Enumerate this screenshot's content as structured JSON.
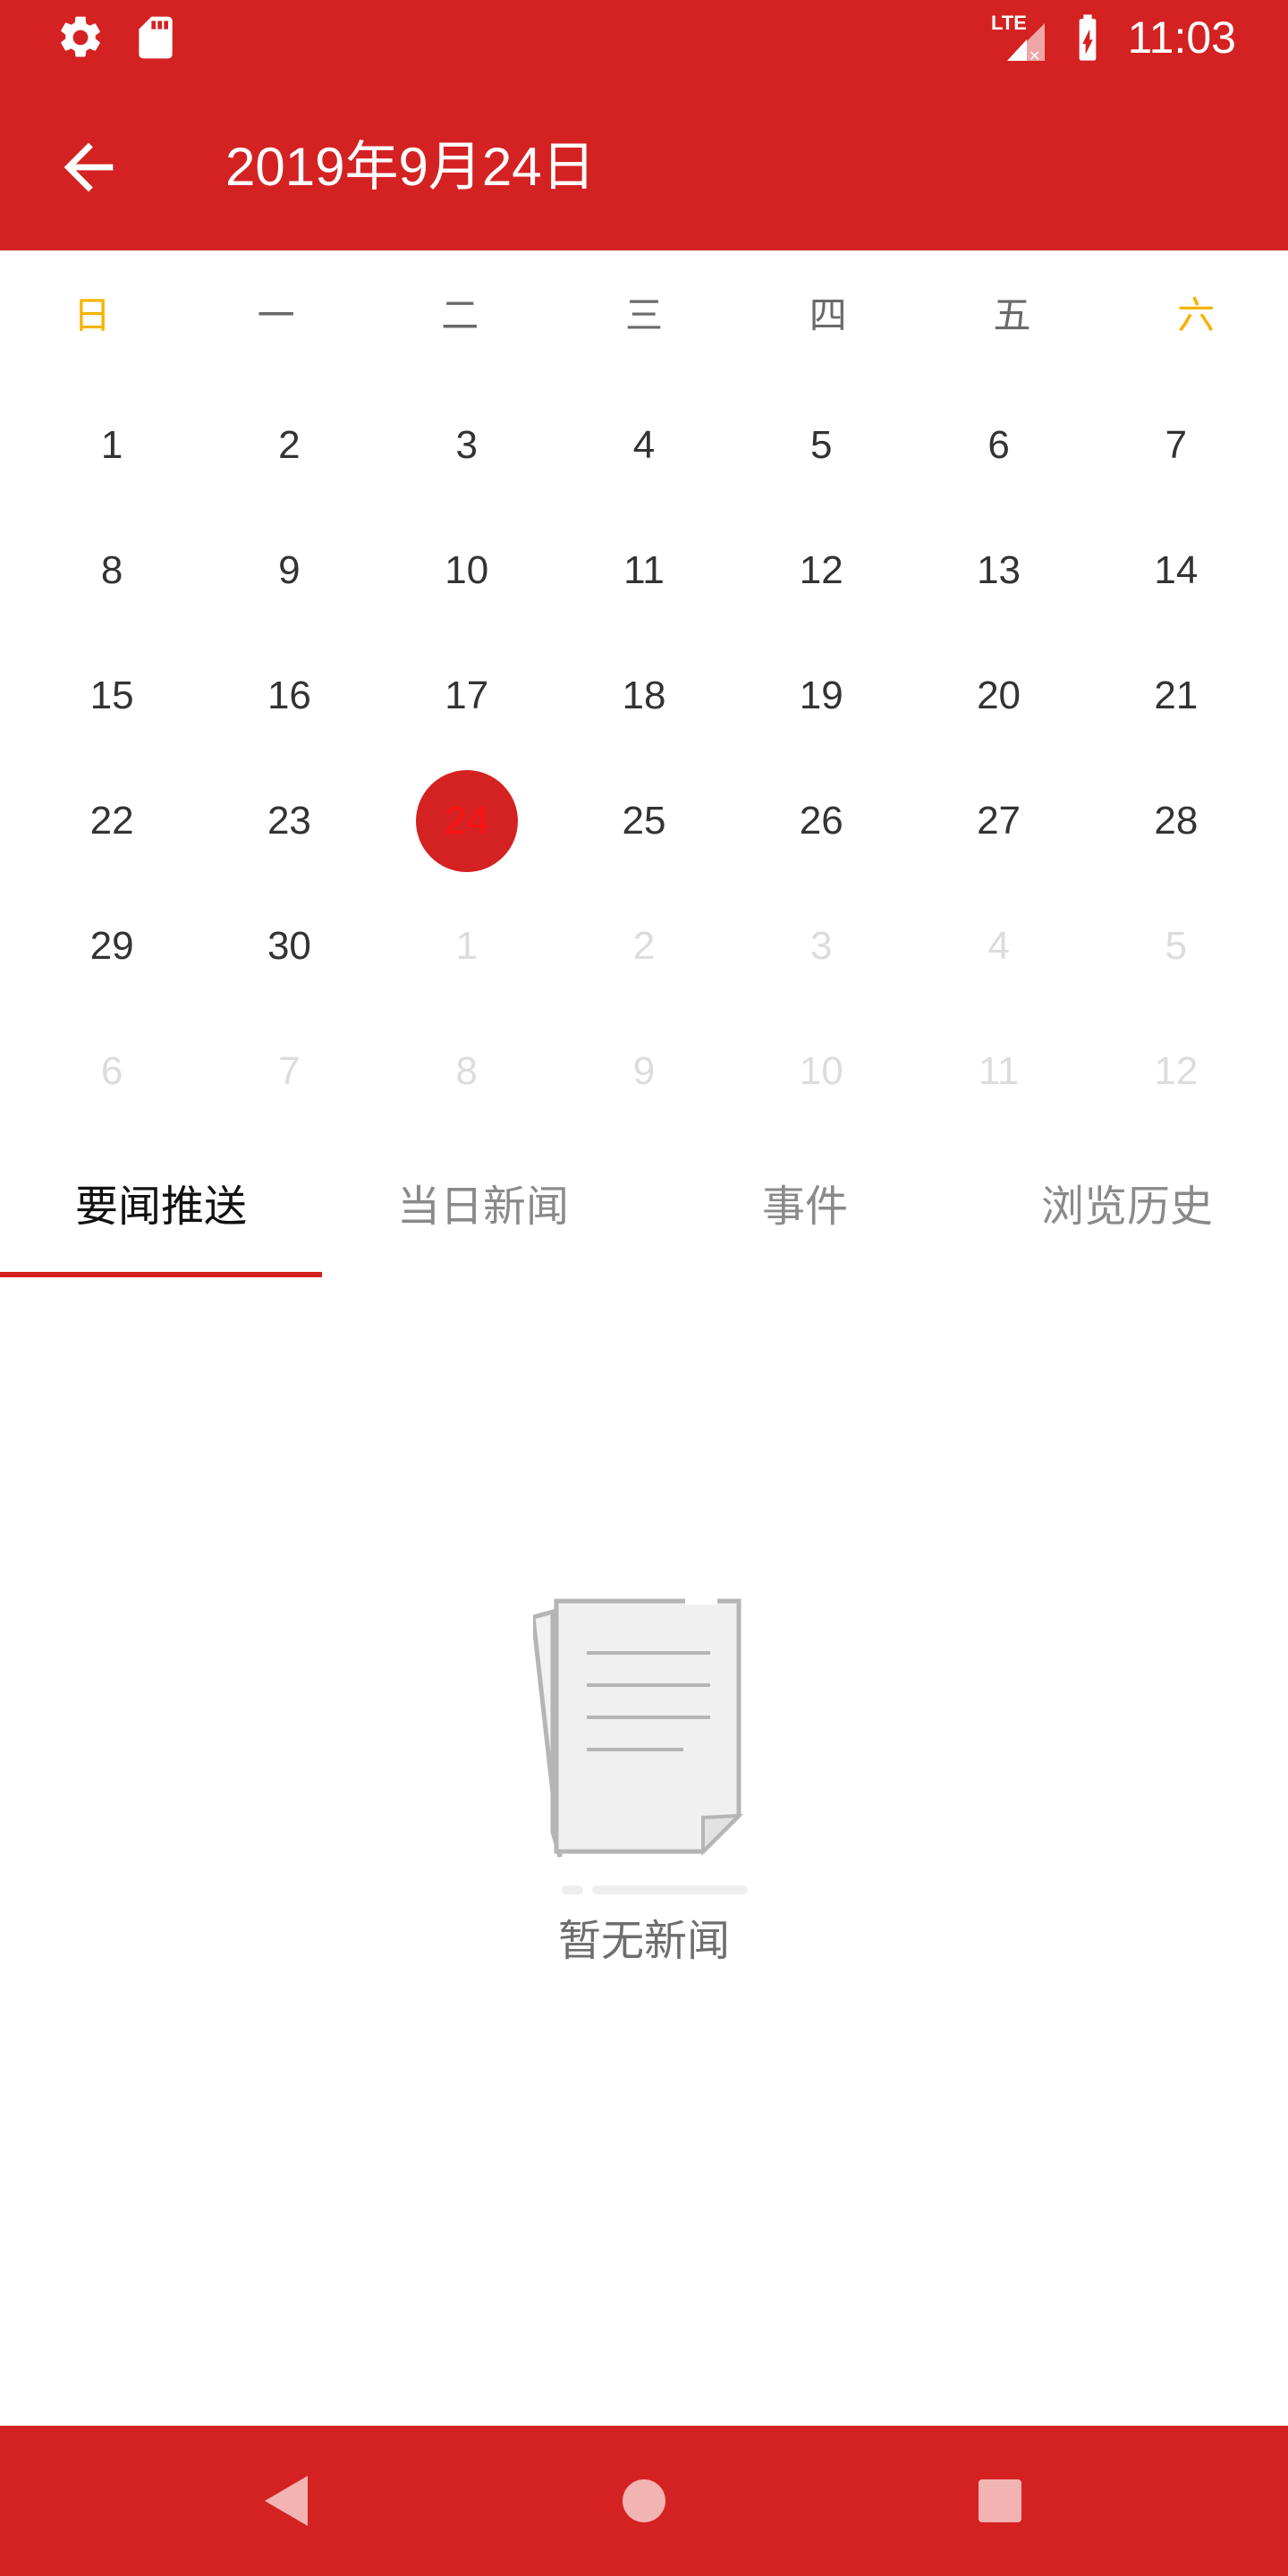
{
  "status_bar": {
    "time": "11:03",
    "network": "LTE",
    "icons": [
      "settings-icon",
      "sd-card-icon",
      "signal-icon",
      "battery-charging-icon"
    ]
  },
  "app_bar": {
    "title": "2019年9月24日",
    "back_icon": "arrow-left-icon"
  },
  "calendar": {
    "weekdays": [
      "日",
      "一",
      "二",
      "三",
      "四",
      "五",
      "六"
    ],
    "weekend_color": "#f5b400",
    "selected_day": "24",
    "accent": "#d42222",
    "days": [
      {
        "label": "1",
        "muted": false
      },
      {
        "label": "2",
        "muted": false
      },
      {
        "label": "3",
        "muted": false
      },
      {
        "label": "4",
        "muted": false
      },
      {
        "label": "5",
        "muted": false
      },
      {
        "label": "6",
        "muted": false
      },
      {
        "label": "7",
        "muted": false
      },
      {
        "label": "8",
        "muted": false
      },
      {
        "label": "9",
        "muted": false
      },
      {
        "label": "10",
        "muted": false
      },
      {
        "label": "11",
        "muted": false
      },
      {
        "label": "12",
        "muted": false
      },
      {
        "label": "13",
        "muted": false
      },
      {
        "label": "14",
        "muted": false
      },
      {
        "label": "15",
        "muted": false
      },
      {
        "label": "16",
        "muted": false
      },
      {
        "label": "17",
        "muted": false
      },
      {
        "label": "18",
        "muted": false
      },
      {
        "label": "19",
        "muted": false
      },
      {
        "label": "20",
        "muted": false
      },
      {
        "label": "21",
        "muted": false
      },
      {
        "label": "22",
        "muted": false
      },
      {
        "label": "23",
        "muted": false
      },
      {
        "label": "24",
        "muted": false
      },
      {
        "label": "25",
        "muted": false
      },
      {
        "label": "26",
        "muted": false
      },
      {
        "label": "27",
        "muted": false
      },
      {
        "label": "28",
        "muted": false
      },
      {
        "label": "29",
        "muted": false
      },
      {
        "label": "30",
        "muted": false
      },
      {
        "label": "1",
        "muted": true
      },
      {
        "label": "2",
        "muted": true
      },
      {
        "label": "3",
        "muted": true
      },
      {
        "label": "4",
        "muted": true
      },
      {
        "label": "5",
        "muted": true
      },
      {
        "label": "6",
        "muted": true
      },
      {
        "label": "7",
        "muted": true
      },
      {
        "label": "8",
        "muted": true
      },
      {
        "label": "9",
        "muted": true
      },
      {
        "label": "10",
        "muted": true
      },
      {
        "label": "11",
        "muted": true
      },
      {
        "label": "12",
        "muted": true
      }
    ]
  },
  "tabs": [
    {
      "label": "要闻推送",
      "active": true
    },
    {
      "label": "当日新闻",
      "active": false
    },
    {
      "label": "事件",
      "active": false
    },
    {
      "label": "浏览历史",
      "active": false
    }
  ],
  "empty_state": {
    "text": "暂无新闻",
    "icon": "empty-document-icon"
  },
  "nav_bar": {
    "buttons": [
      "back-triangle-icon",
      "home-circle-icon",
      "recents-square-icon"
    ]
  }
}
